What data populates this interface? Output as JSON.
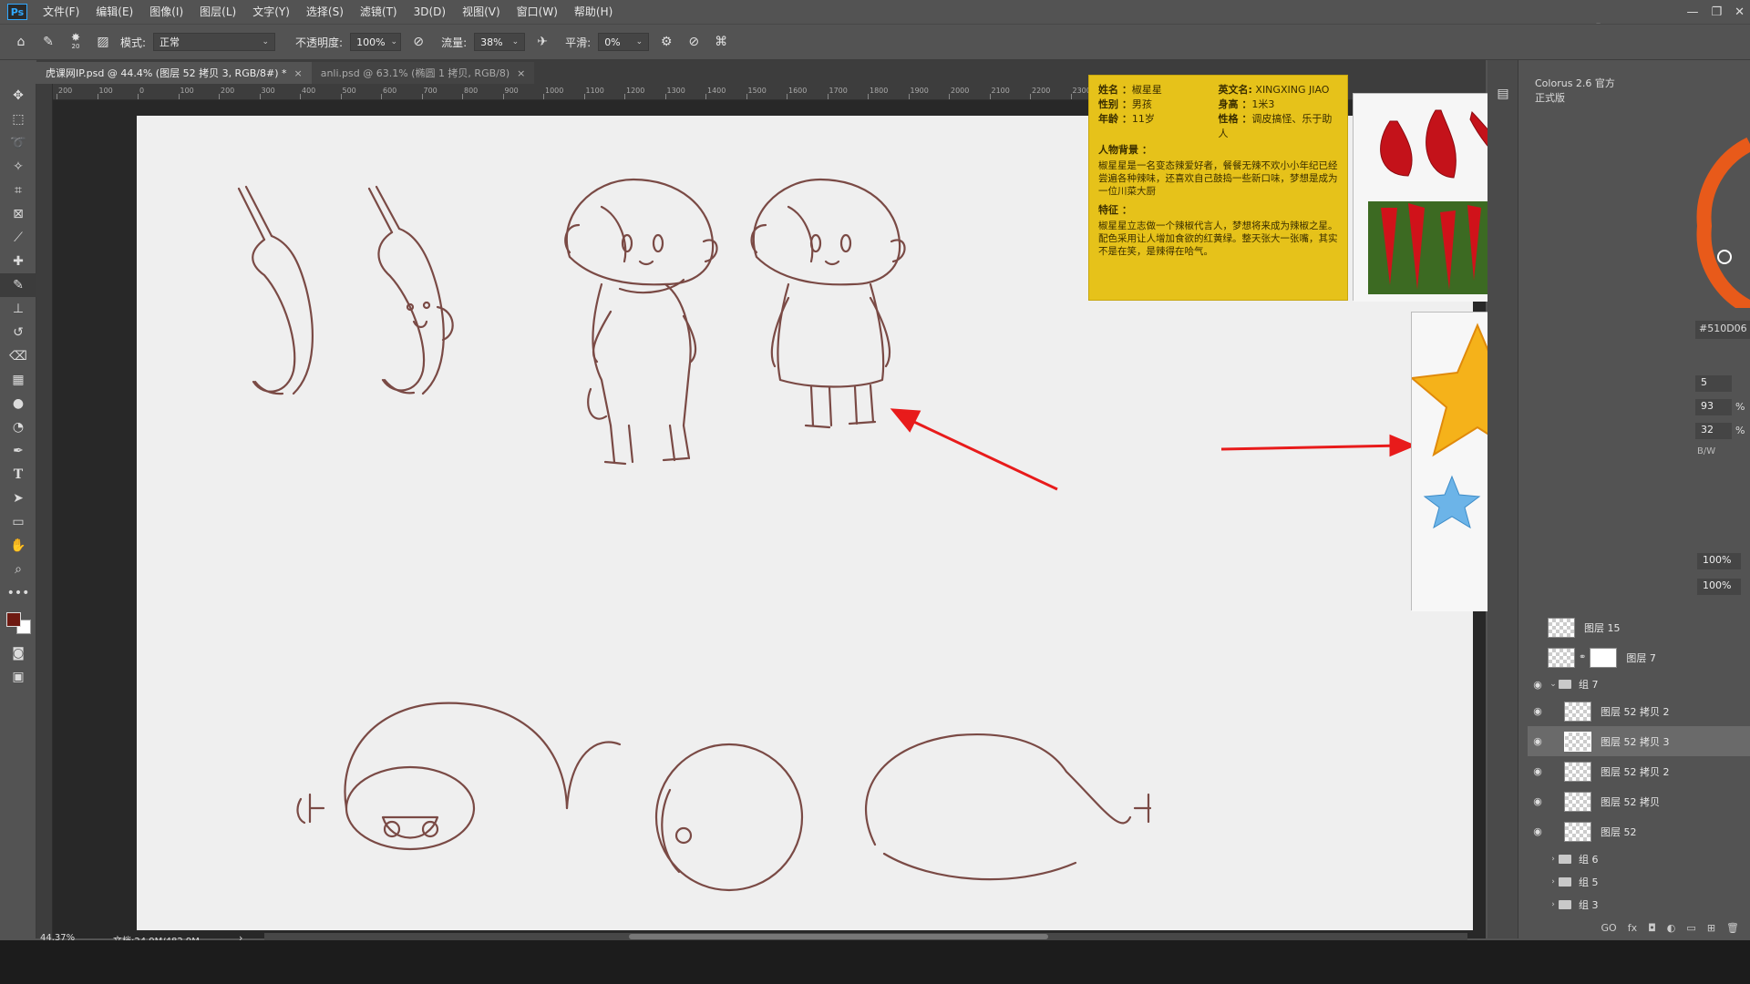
{
  "app": {
    "logo": "Ps",
    "menu": [
      "文件(F)",
      "编辑(E)",
      "图像(I)",
      "图层(L)",
      "文字(Y)",
      "选择(S)",
      "滤镜(T)",
      "3D(D)",
      "视图(V)",
      "窗口(W)",
      "帮助(H)"
    ],
    "window_controls": [
      "—",
      "❐",
      "✕"
    ],
    "watermark": "虎课网"
  },
  "options": {
    "brush_size": "20",
    "mode_label": "模式:",
    "mode_value": "正常",
    "opacity_label": "不透明度:",
    "opacity_value": "100%",
    "flow_label": "流量:",
    "flow_value": "38%",
    "smooth_label": "平滑:",
    "smooth_value": "0%"
  },
  "tabs": [
    {
      "label": "虎课网IP.psd @ 44.4% (图层 52 拷贝 3, RGB/8#) *",
      "active": true
    },
    {
      "label": "anli.psd @ 63.1% (椭圆 1 拷贝, RGB/8)",
      "active": false
    }
  ],
  "ruler_ticks": [
    "200",
    "100",
    "0",
    "100",
    "200",
    "300",
    "400",
    "500",
    "600",
    "700",
    "800",
    "900",
    "1000",
    "1100",
    "1200",
    "1300",
    "1400",
    "1500",
    "1600",
    "1700",
    "1800",
    "1900",
    "2000",
    "2100",
    "2200",
    "2300"
  ],
  "info_card": {
    "name_label": "姓名 ：",
    "name_value": "椒星星",
    "en_label": "英文名:",
    "en_value": "XINGXING JIAO",
    "gender_label": "性别 ：",
    "gender_value": "男孩",
    "height_label": "身高 ：",
    "height_value": "1米3",
    "age_label": "年龄 ：",
    "age_value": "11岁",
    "character_label": "性格 ：",
    "character_value": "调皮搞怪、乐于助人",
    "background_title": "人物背景 ：",
    "background_text": "椒星星是一名变态辣爱好者，餐餐无辣不欢小小年纪已经尝遍各种辣味，还喜欢自己鼓捣一些新口味，梦想是成为一位川菜大厨",
    "feature_title": "特征 ：",
    "feature_text": "椒星星立志做一个辣椒代言人，梦想将来成为辣椒之星。配色采用让人增加食欲的红黄绿。整天张大一张嘴，其实不是在笑，是辣得在哈气。"
  },
  "right_panel": {
    "plugin_tab": "Colorus 2.6 官方正式版",
    "hex": "#510D06",
    "values": [
      "5",
      "93",
      "32"
    ],
    "pct_sign": "%",
    "bw_label": "B/W",
    "opacity_rows": [
      "100%",
      "100%"
    ]
  },
  "layers": [
    {
      "name": "图层 15",
      "type": "layer",
      "visible": false,
      "indent": 0
    },
    {
      "name": "图层 7",
      "type": "layer-mask",
      "visible": false,
      "indent": 0
    },
    {
      "name": "组 7",
      "type": "group-open",
      "visible": true,
      "indent": 0
    },
    {
      "name": "图层 52 拷贝 2",
      "type": "layer",
      "visible": true,
      "indent": 1
    },
    {
      "name": "图层 52 拷贝 3",
      "type": "layer",
      "visible": true,
      "indent": 1,
      "selected": true
    },
    {
      "name": "图层 52 拷贝 2",
      "type": "layer",
      "visible": true,
      "indent": 1
    },
    {
      "name": "图层 52 拷贝",
      "type": "layer",
      "visible": true,
      "indent": 1
    },
    {
      "name": "图层 52",
      "type": "layer",
      "visible": true,
      "indent": 1
    },
    {
      "name": "组 6",
      "type": "group",
      "visible": false,
      "indent": 0
    },
    {
      "name": "组 5",
      "type": "group",
      "visible": false,
      "indent": 0
    },
    {
      "name": "组 3",
      "type": "group",
      "visible": false,
      "indent": 0
    }
  ],
  "layer_footer": [
    "GO",
    "fx",
    "◘",
    "◐",
    "▭",
    "⊞",
    "🗑"
  ],
  "status": {
    "zoom": "44.37%",
    "doc": "文档:24.9M/482.9M",
    "arrow": "›"
  },
  "colors": {
    "foreground": "#6e1a12",
    "background": "#ffffff",
    "sketch": "#7a4a45",
    "arrow": "#e81b1b",
    "card": "#e6c21a"
  }
}
